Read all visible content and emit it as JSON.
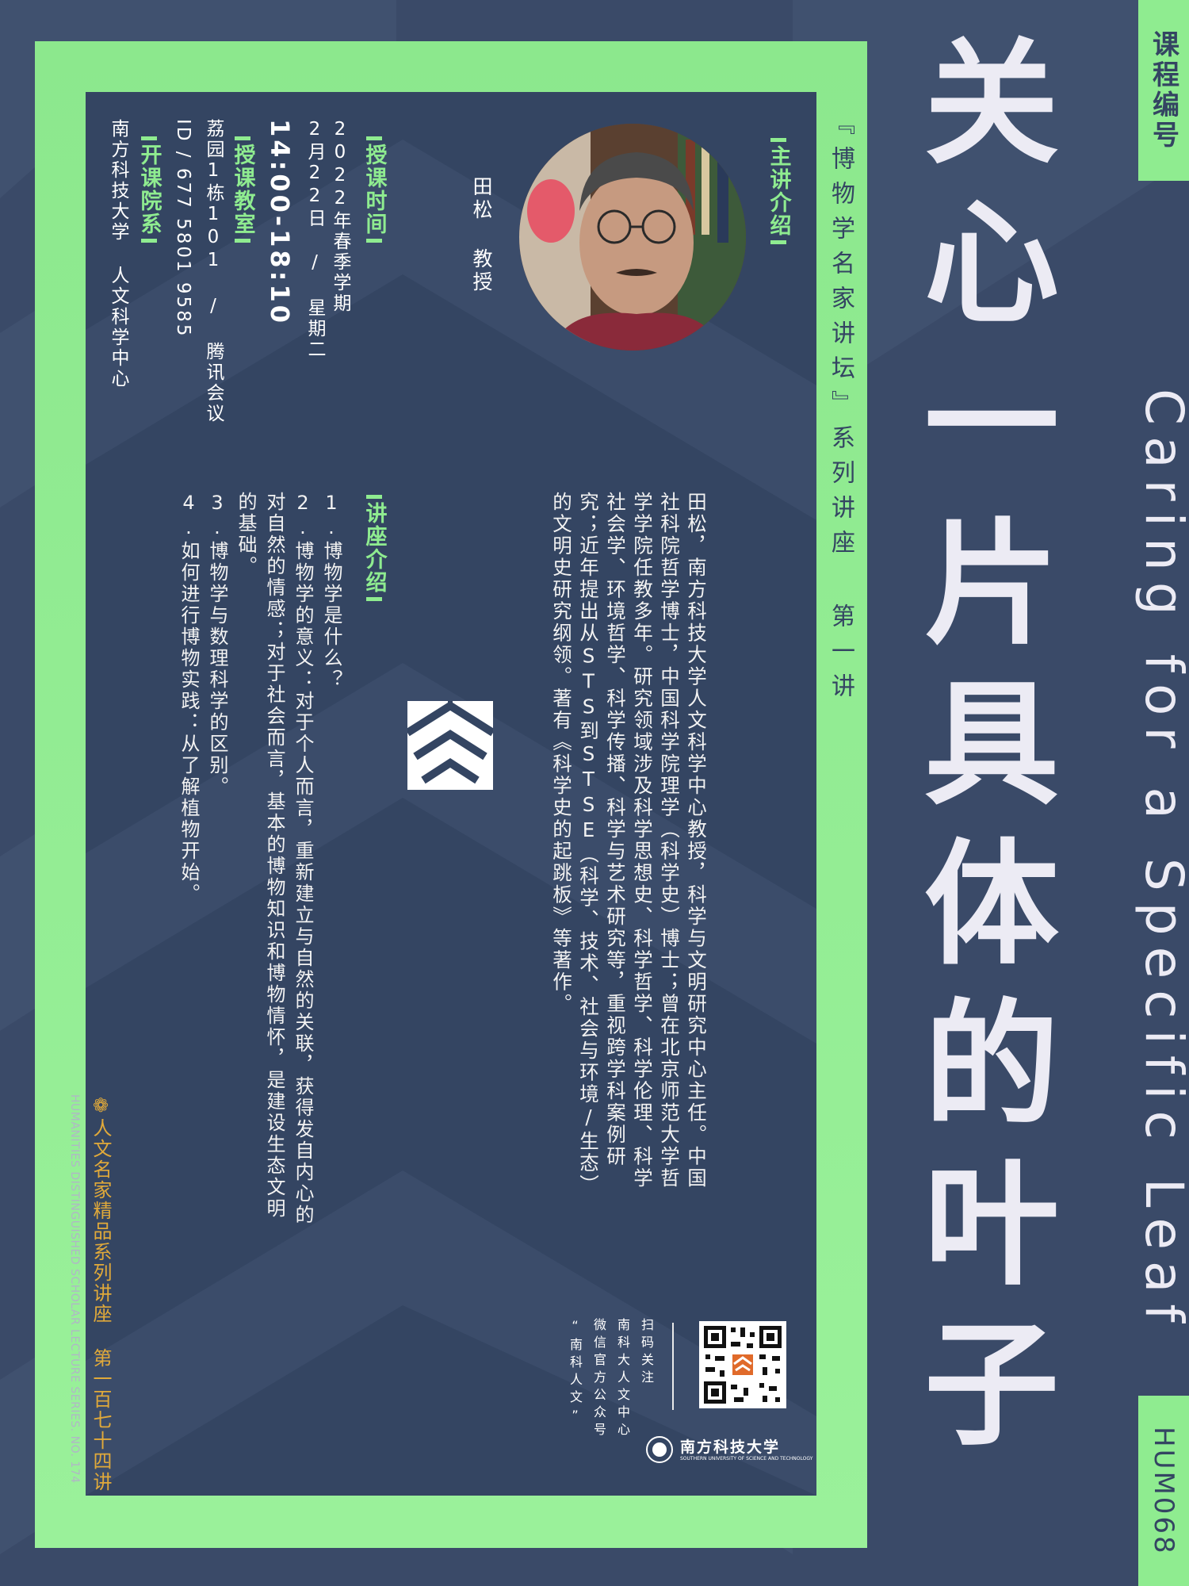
{
  "colors": {
    "background": "#3a4a68",
    "panel": "#344562",
    "accent_green": "#8fec90",
    "title": "#ecebf4",
    "footer_gold": "#e0a93a"
  },
  "title": {
    "cn": "关心一片具体的叶子",
    "en": "Caring for a Specific Leaf"
  },
  "tabs": {
    "course_label": "课程编号",
    "course_code": "HUM068"
  },
  "series": "『博物学名家讲坛』系列讲座 第一讲",
  "speaker": {
    "heading": "主讲介绍",
    "name": "田松 教授",
    "bio": "田松，南方科技大学人文科学中心教授，科学与文明研究中心主任。中国社科院哲学博士，中国科学院理学（科学史）博士；曾在北京师范大学哲学学院任教多年。研究领域涉及科学思想史、科学哲学、科学伦理、科学社会学、环境哲学、科学传播、科学与艺术研究等，重视跨学科案例研究；近年提出从STS到STSE（科学、技术、社会与环境/生态）的文明史研究纲领。著有《科学史的起跳板》等著作。"
  },
  "lecture": {
    "heading": "讲座介绍",
    "items": [
      "1.博物学是什么？",
      "2.博物学的意义：对于个人而言，重新建立与自然的关联，获得发自内心的对自然的情感；对于社会而言，基本的博物知识和博物情怀，是建设生态文明的基础。",
      "3.博物学与数理科学的区别。",
      "4.如何进行博物实践：从了解植物开始。"
    ]
  },
  "info": {
    "time_heading": "授课时间",
    "term": "2022年春季学期",
    "date": "2月22日 / 星期二",
    "time": "14:00-18:10",
    "room_heading": "授课教室",
    "room": "荔园1栋101 / 腾讯会议",
    "meeting_id": "ID / 677 5801 9585",
    "dept_heading": "开课院系",
    "dept": "南方科技大学 人文科学中心"
  },
  "footer": {
    "cn": "人文名家精品系列讲座 第一百七十四讲",
    "en": "HUMANITIES DISTINGUISHED SCHOLAR LECTURE SERIES. NO. 174"
  },
  "qr": {
    "lines": [
      "扫码关注",
      "南科大人文中心",
      "微信官方公众号",
      "“南科人文”"
    ]
  },
  "university": {
    "name_cn": "南方科技大学",
    "name_en": "SOUTHERN UNIVERSITY OF SCIENCE AND TECHNOLOGY"
  }
}
